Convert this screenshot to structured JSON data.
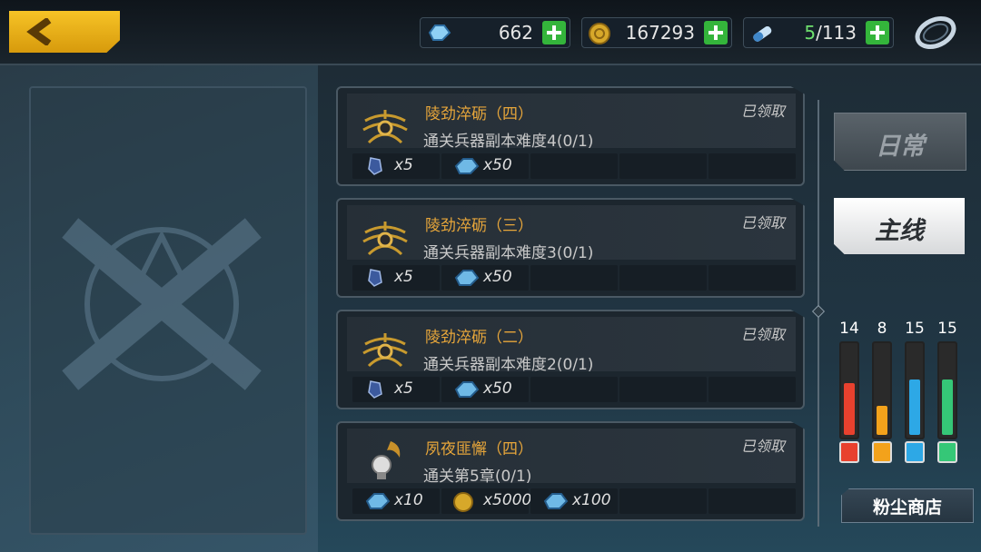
{
  "topbar": {
    "back_label": "",
    "crystals": {
      "value": "662",
      "icon": "crystal-icon"
    },
    "gold": {
      "value": "167293",
      "icon": "gold-coin-icon"
    },
    "stamina": {
      "current": "5",
      "max": "/113",
      "icon": "stamina-pill-icon"
    }
  },
  "quests": [
    {
      "title": "陵劲淬砺（四）",
      "desc": "通关兵器副本难度4(0/1)",
      "status": "已领取",
      "rewards": [
        {
          "icon": "shard-icon",
          "qty": "x5"
        },
        {
          "icon": "crystal-icon",
          "qty": "x50"
        }
      ]
    },
    {
      "title": "陵劲淬砺（三）",
      "desc": "通关兵器副本难度3(0/1)",
      "status": "已领取",
      "rewards": [
        {
          "icon": "shard-icon",
          "qty": "x5"
        },
        {
          "icon": "crystal-icon",
          "qty": "x50"
        }
      ]
    },
    {
      "title": "陵劲淬砺（二）",
      "desc": "通关兵器副本难度2(0/1)",
      "status": "已领取",
      "rewards": [
        {
          "icon": "shard-icon",
          "qty": "x5"
        },
        {
          "icon": "crystal-icon",
          "qty": "x50"
        }
      ]
    },
    {
      "title": "夙夜匪懈（四）",
      "desc": "通关第5章(0/1)",
      "status": "已领取",
      "rewards": [
        {
          "icon": "crystal-icon",
          "qty": "x10"
        },
        {
          "icon": "gold-coin-icon",
          "qty": "x5000"
        },
        {
          "icon": "crystal-icon",
          "qty": "x100"
        }
      ]
    }
  ],
  "tabs": {
    "daily": "日常",
    "main": "主线"
  },
  "gauges": [
    {
      "value": "14",
      "color": "#e8412e",
      "level": 0.58
    },
    {
      "value": "8",
      "color": "#f3a21b",
      "level": 0.33
    },
    {
      "value": "15",
      "color": "#2da8e6",
      "level": 0.62
    },
    {
      "value": "15",
      "color": "#35c777",
      "level": 0.62
    }
  ],
  "shop_label": "粉尘商店",
  "colors": {
    "accent": "#f6c326",
    "quest_title": "#e7a63a",
    "plus": "#34b53b"
  }
}
